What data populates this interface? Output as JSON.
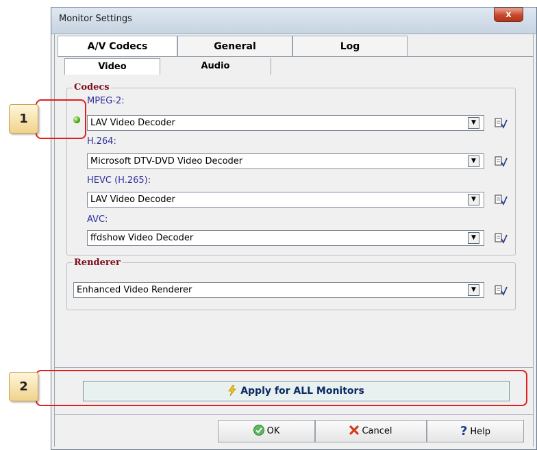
{
  "window": {
    "title": "Monitor Settings",
    "close_glyph": "x"
  },
  "tabs": [
    {
      "label": "A/V Codecs",
      "active": true
    },
    {
      "label": "General",
      "active": false
    },
    {
      "label": "Log",
      "active": false
    }
  ],
  "subtabs": [
    {
      "label": "Video",
      "active": true
    },
    {
      "label": "Audio",
      "active": false
    }
  ],
  "codecs": {
    "legend": "Codecs",
    "items": [
      {
        "label": "MPEG-2:",
        "value": "LAV Video Decoder",
        "status": "active-green"
      },
      {
        "label": "H.264:",
        "value": "Microsoft DTV-DVD Video Decoder"
      },
      {
        "label": "HEVC (H.265):",
        "value": "LAV Video Decoder"
      },
      {
        "label": "AVC:",
        "value": "ffdshow Video Decoder"
      }
    ]
  },
  "renderer": {
    "legend": "Renderer",
    "value": "Enhanced Video Renderer"
  },
  "apply_button": {
    "label": "Apply for ALL Monitors",
    "icon": "lightning-icon"
  },
  "buttons": {
    "ok": {
      "label": "OK",
      "icon": "check-icon"
    },
    "cancel": {
      "label": "Cancel",
      "icon": "x-icon"
    },
    "help": {
      "label": "Help",
      "icon": "question-icon"
    }
  },
  "callouts": [
    {
      "number": "1"
    },
    {
      "number": "2"
    }
  ],
  "colors": {
    "callout_border": "#e01e1e",
    "group_label": "#7a0f1b",
    "codec_label": "#2e2f9e",
    "status_green": "#3fa40f"
  }
}
